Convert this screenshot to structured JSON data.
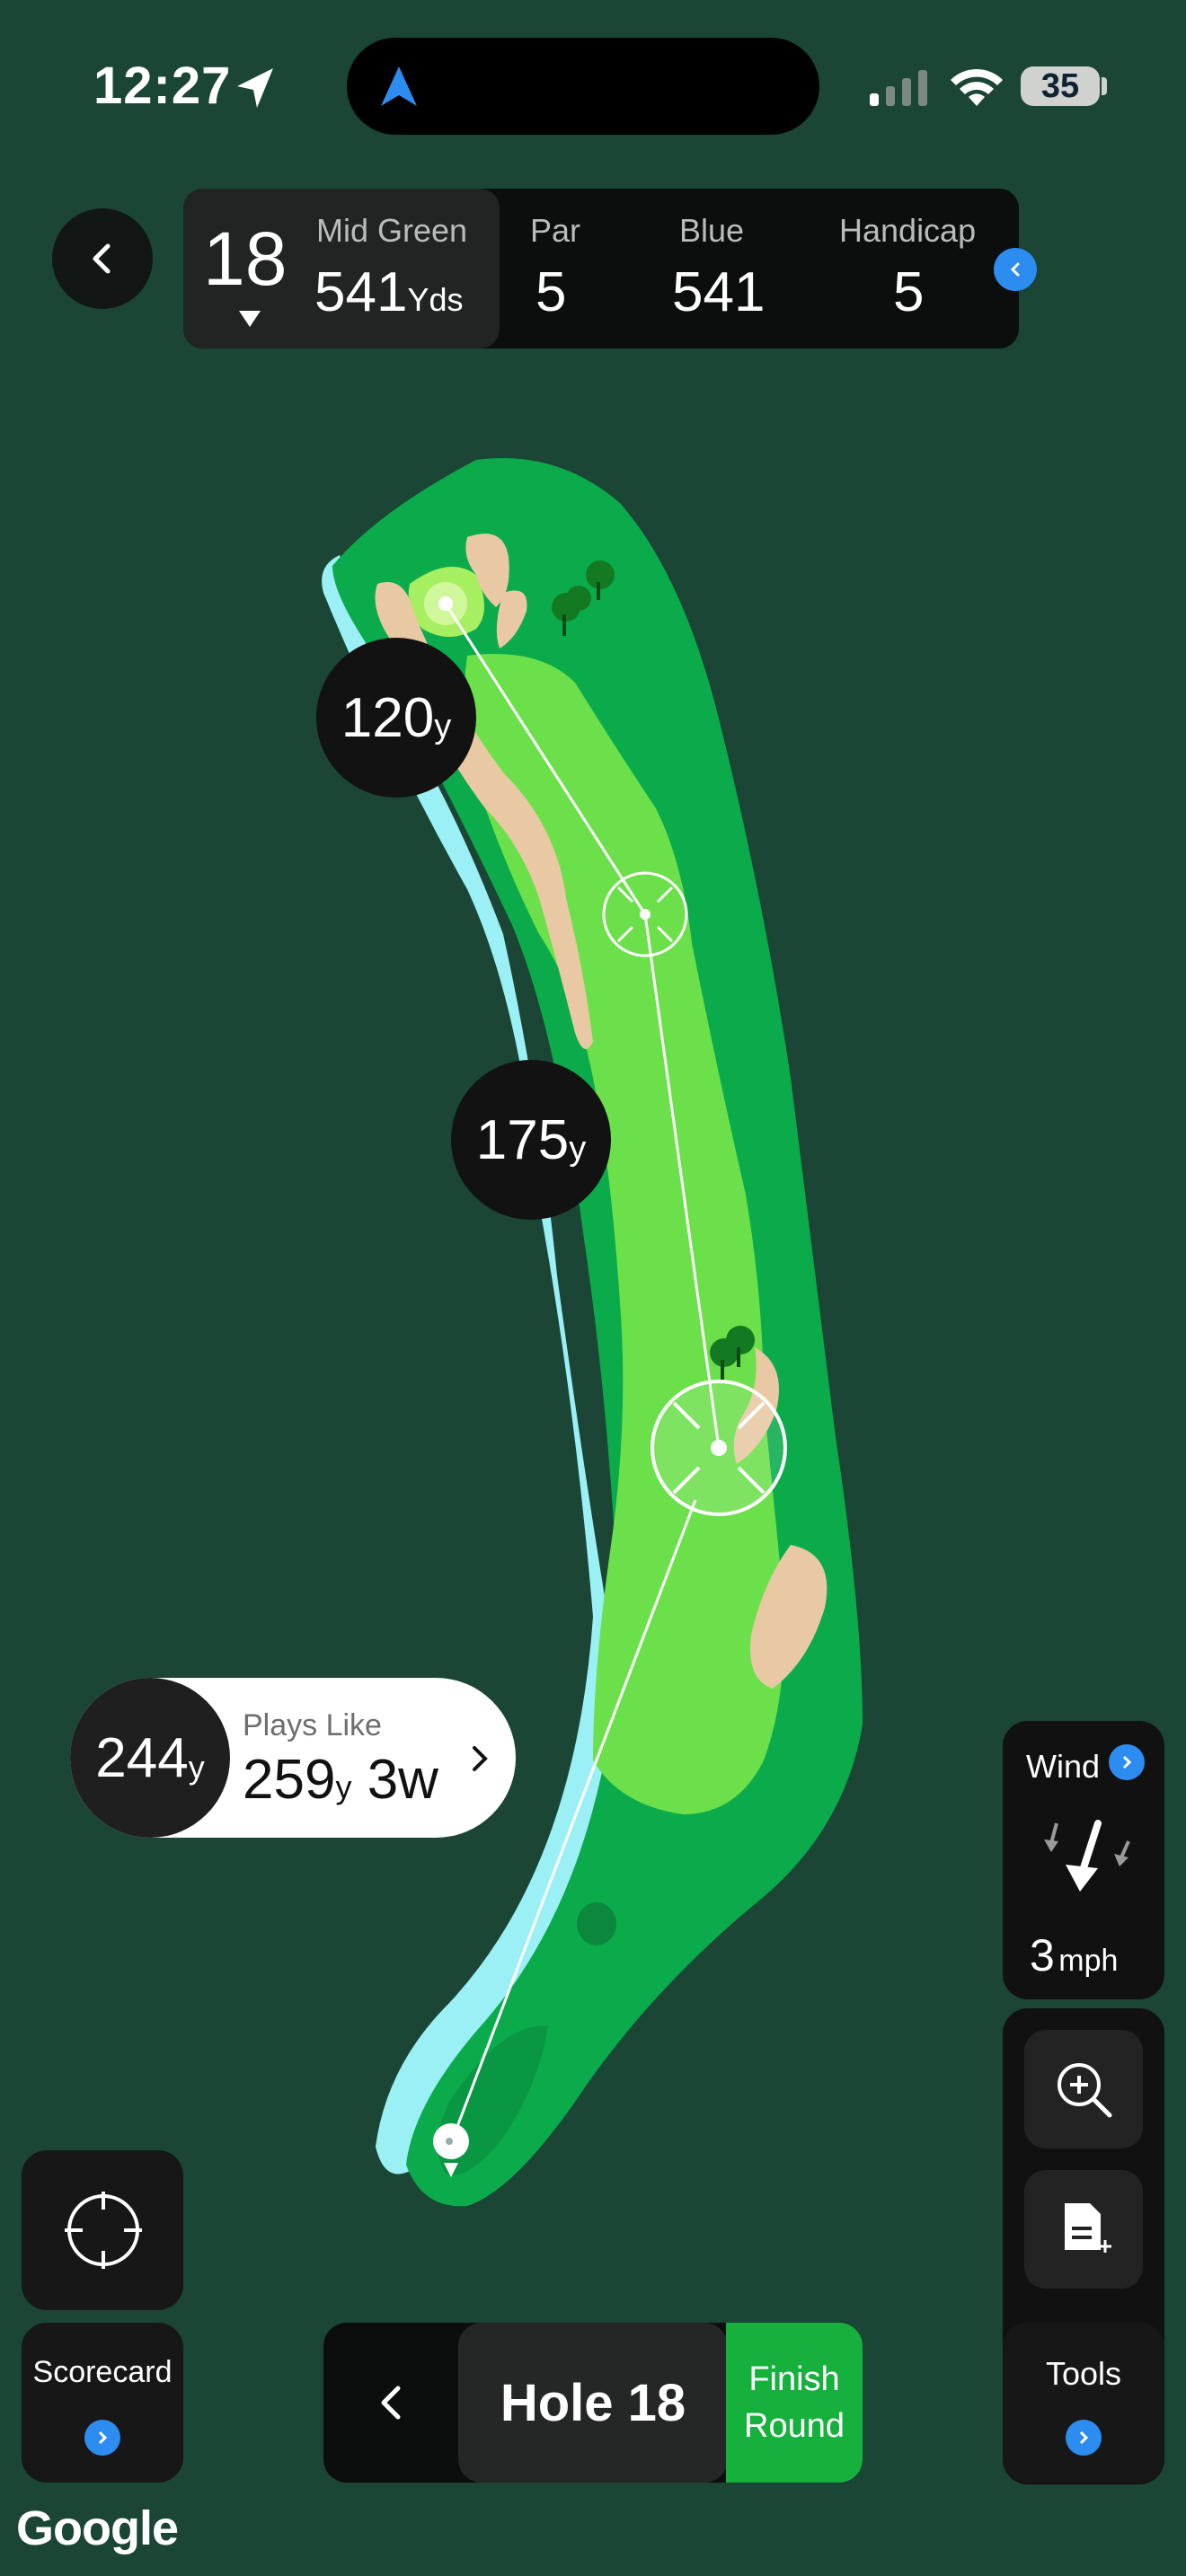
{
  "status_bar": {
    "time": "12:27",
    "battery": "35"
  },
  "hole_info": {
    "hole_number": "18",
    "tee_label": "Mid Green",
    "tee_yards": "541",
    "yards_unit": "Yds",
    "par_label": "Par",
    "par_value": "5",
    "blue_label": "Blue",
    "blue_value": "541",
    "handicap_label": "Handicap",
    "handicap_value": "5"
  },
  "map": {
    "dist_far": {
      "value": "120",
      "unit": "y"
    },
    "dist_mid": {
      "value": "175",
      "unit": "y"
    }
  },
  "plays_like": {
    "distance": "244",
    "distance_unit": "y",
    "label": "Plays Like",
    "adjusted": "259",
    "adjusted_unit": "y",
    "club": "3w"
  },
  "wind": {
    "label": "Wind",
    "speed": "3",
    "unit": "mph"
  },
  "scorecard_label": "Scorecard",
  "tools_label": "Tools",
  "bottom_nav": {
    "hole_label": "Hole 18",
    "finish_line1": "Finish",
    "finish_line2": "Round"
  },
  "map_attribution": "Google",
  "colors": {
    "background": "#1b4534",
    "rough": "#0bab4c",
    "fairway": "#6ce04a",
    "water": "#9bf0f6",
    "sand": "#e8c9a3",
    "accent_blue": "#2d8cf0",
    "finish_green": "#16b13d"
  }
}
